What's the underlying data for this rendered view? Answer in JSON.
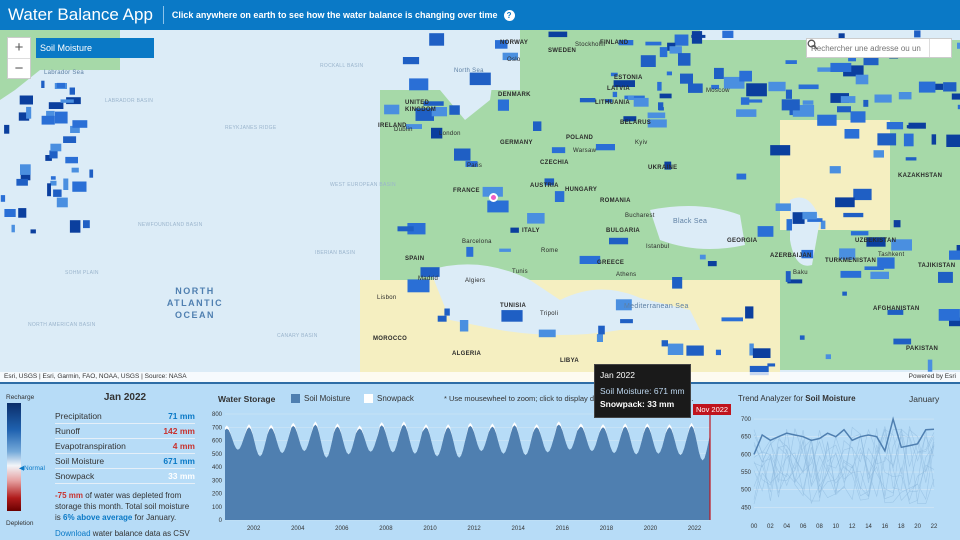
{
  "header": {
    "title": "Water Balance App",
    "subtitle": "Click anywhere on earth to see how the water balance is changing over time"
  },
  "map": {
    "layer": "Soil Moisture",
    "search_placeholder": "Rechercher une adresse ou un",
    "attribution_left": "Esri, USGS | Esri, Garmin, FAO, NOAA, USGS | Source: NASA",
    "attribution_right": "Powered by Esri",
    "labels": {
      "labrador_sea": "Labrador Sea",
      "labrador_basin": "LABRADOR BASIN",
      "north_sea": "North Sea",
      "rockall": "ROCKALL BASIN",
      "reykjanes": "REYKJANES RIDGE",
      "west_european": "WEST EUROPEAN BASIN",
      "newfoundland": "NEWFOUNDLAND BASIN",
      "iberian": "IBERIAN BASIN",
      "sohm": "SOHM PLAIN",
      "north_american": "NORTH AMERICAN BASIN",
      "canary": "CANARY BASIN",
      "north_atlantic": "NORTH ATLANTIC OCEAN",
      "ireland": "IRELAND",
      "uk": "UNITED KINGDOM",
      "france": "FRANCE",
      "germany": "GERMANY",
      "spain": "SPAIN",
      "italy": "ITALY",
      "poland": "POLAND",
      "czechia": "CZECHIA",
      "austria": "AUSTRIA",
      "hungary": "HUNGARY",
      "romania": "ROMANIA",
      "bulgaria": "BULGARIA",
      "greece": "GREECE",
      "ukraine": "UKRAINE",
      "belarus": "BELARUS",
      "lithuania": "LITHUANIA",
      "latvia": "LATVIA",
      "estonia": "ESTONIA",
      "finland": "FINLAND",
      "sweden": "SWEDEN",
      "norway": "NORWAY",
      "denmark": "DENMARK",
      "morocco": "MOROCCO",
      "algeria": "ALGERIA",
      "tunisia": "TUNISIA",
      "libya": "LIBYA",
      "georgia": "GEORGIA",
      "azerbaijan": "AZERBAIJAN",
      "kazakhstan": "KAZAKHSTAN",
      "uzbekistan": "UZBEKISTAN",
      "turkmenistan": "TURKMENISTAN",
      "tajikistan": "TAJIKISTAN",
      "afghanistan": "AFGHANISTAN",
      "pakistan": "PAKISTAN",
      "black_sea": "Black Sea",
      "med_sea": "Mediterranean Sea",
      "stockholm": "Stockholm",
      "moscow": "Moscow",
      "madrid": "Madrid",
      "rome": "Rome",
      "paris": "Paris",
      "london": "London",
      "warsaw": "Warsaw",
      "kyiv": "Kyiv",
      "tashkent": "Tashkent",
      "tripoli": "Tripoli",
      "algiers": "Algiers",
      "tunis": "Tunis",
      "barcelona": "Barcelona",
      "lisbon": "Lisbon",
      "athens": "Athens",
      "istanbul": "Istanbul",
      "bucharest": "Bucharest",
      "oslo": "Oslo",
      "dublin": "Dublin",
      "baku": "Baku"
    }
  },
  "legend": {
    "top": "Recharge",
    "middle": "Normal",
    "bottom": "Depletion"
  },
  "stats": {
    "month": "Jan 2022",
    "rows": [
      {
        "label": "Precipitation",
        "value": "71 mm"
      },
      {
        "label": "Runoff",
        "value": "142 mm"
      },
      {
        "label": "Evapotranspiration",
        "value": "4 mm"
      },
      {
        "label": "Soil Moisture",
        "value": "671 mm"
      },
      {
        "label": "Snowpack",
        "value": "33 mm"
      }
    ],
    "summary_neg": "-75 mm",
    "summary_mid": " of water was depleted from storage this month. Total soil moisture is ",
    "summary_pos": "6% above average",
    "summary_end": " for January.",
    "download_link": "Download",
    "download_rest": " water balance data as CSV"
  },
  "water_storage": {
    "title": "Water Storage",
    "legend_soil": "Soil Moisture",
    "legend_snow": "Snowpack",
    "hint": "* Use mousewheel to zoom; click to display data for a specific point in time.",
    "date_flag": "Nov 2022",
    "colors": {
      "soil": "#4f7fb0",
      "snow": "#ffffff",
      "flag": "#c0141d"
    }
  },
  "tooltip": {
    "title": "Jan 2022",
    "soil": "Soil Moisture: 671 mm",
    "snow": "Snowpack: 33 mm"
  },
  "trend": {
    "title_prefix": "Trend Analyzer for ",
    "title_layer": "Soil Moisture",
    "month": "January"
  },
  "chart_data": [
    {
      "type": "area",
      "title": "Water Storage",
      "series": [
        {
          "name": "Soil Moisture"
        },
        {
          "name": "Snowpack"
        }
      ],
      "x_ticks": [
        "2002",
        "2004",
        "2006",
        "2008",
        "2010",
        "2012",
        "2014",
        "2016",
        "2018",
        "2020",
        "2022"
      ],
      "y_ticks": [
        0,
        100,
        200,
        300,
        400,
        500,
        600,
        700,
        800
      ],
      "ylim": [
        0,
        800
      ],
      "annual_min": [
        530,
        480,
        505,
        520,
        470,
        495,
        515,
        510,
        500,
        480,
        470,
        520,
        500,
        490,
        510,
        530,
        520,
        505,
        495,
        500,
        490,
        450
      ],
      "annual_max": [
        690,
        700,
        695,
        710,
        720,
        705,
        690,
        715,
        720,
        700,
        700,
        710,
        705,
        715,
        700,
        720,
        705,
        700,
        705,
        705,
        700,
        710
      ]
    },
    {
      "type": "line",
      "title": "Trend Analyzer for Soil Moisture",
      "x_ticks": [
        "00",
        "02",
        "04",
        "06",
        "08",
        "10",
        "12",
        "14",
        "16",
        "18",
        "20",
        "22"
      ],
      "y_ticks": [
        450,
        500,
        550,
        600,
        650,
        700
      ],
      "ylim": [
        420,
        720
      ],
      "highlight": [
        600,
        655,
        640,
        650,
        660,
        655,
        650,
        640,
        645,
        660,
        650,
        670,
        640,
        650,
        655,
        650,
        610,
        700,
        620,
        625,
        630,
        670,
        671
      ]
    }
  ]
}
